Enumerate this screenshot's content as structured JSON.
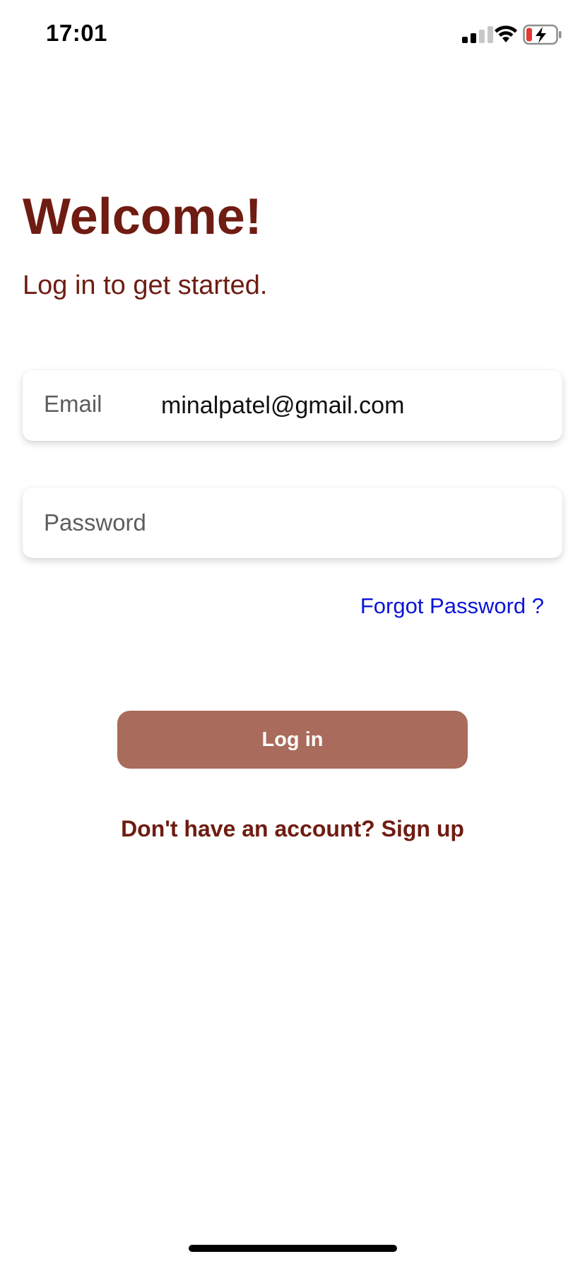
{
  "status_bar": {
    "time": "17:01",
    "signal_icon": "cellular-signal-icon",
    "wifi_icon": "wifi-icon",
    "battery_icon": "battery-charging-icon",
    "battery_low_color": "#e53935"
  },
  "header": {
    "title": "Welcome!",
    "subtitle": "Log in to get started."
  },
  "form": {
    "email_label": "Email",
    "email_value": "minalpatel@gmail.com",
    "password_placeholder": "Password",
    "forgot_password": "Forgot Password ?",
    "login_button": "Log in",
    "signup_prompt": "Don't have an account? Sign up"
  },
  "colors": {
    "primary_text": "#6f1c12",
    "button_background": "#a96b5b",
    "link_blue": "#0a14d9"
  }
}
